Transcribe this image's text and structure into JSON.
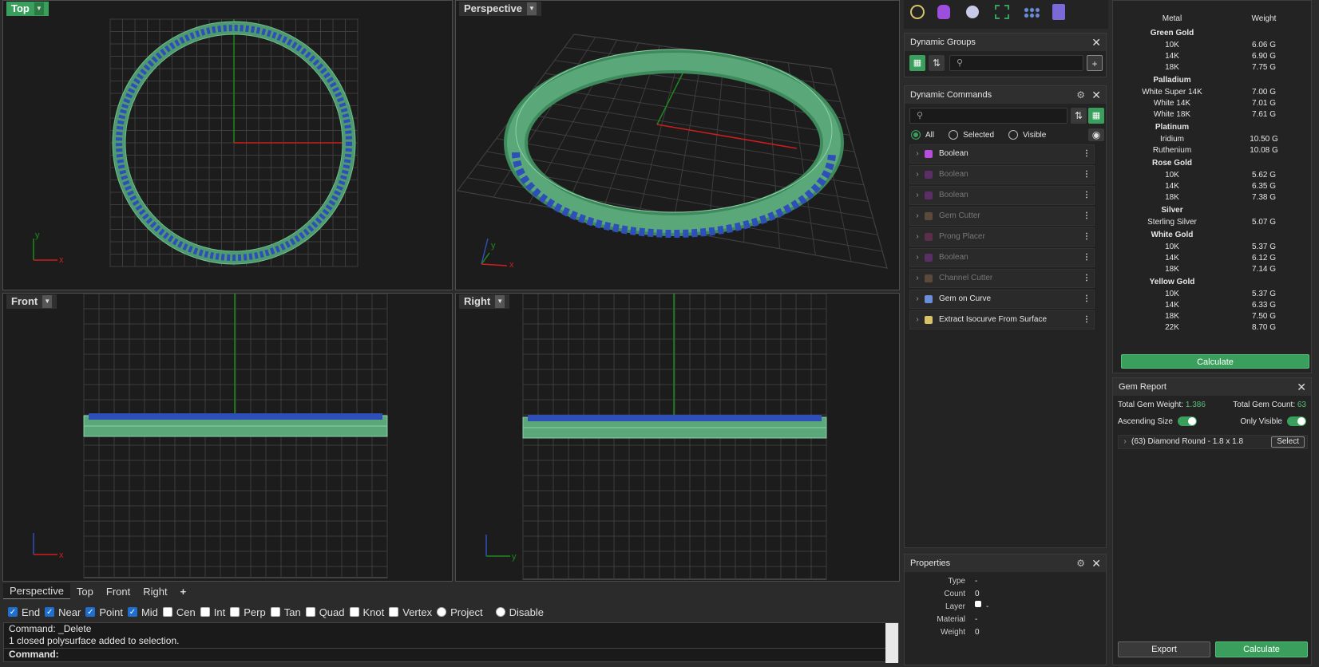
{
  "viewports": {
    "top": {
      "label": "Top",
      "x_axis": "x",
      "y_axis": "y"
    },
    "perspective": {
      "label": "Perspective",
      "x_axis": "x",
      "y_axis": "y"
    },
    "front": {
      "label": "Front",
      "x_axis": "x"
    },
    "right": {
      "label": "Right",
      "y_axis": "y"
    }
  },
  "viewport_tabs": [
    "Perspective",
    "Top",
    "Front",
    "Right"
  ],
  "add_tab": "+",
  "osnaps": [
    {
      "label": "End",
      "checked": true
    },
    {
      "label": "Near",
      "checked": true
    },
    {
      "label": "Point",
      "checked": true
    },
    {
      "label": "Mid",
      "checked": true
    },
    {
      "label": "Cen",
      "checked": false
    },
    {
      "label": "Int",
      "checked": false
    },
    {
      "label": "Perp",
      "checked": false
    },
    {
      "label": "Tan",
      "checked": false
    },
    {
      "label": "Quad",
      "checked": false
    },
    {
      "label": "Knot",
      "checked": false
    },
    {
      "label": "Vertex",
      "checked": false
    },
    {
      "label": "Project",
      "checked": false,
      "radio": true
    },
    {
      "label": "Disable",
      "checked": false,
      "radio": true
    }
  ],
  "command": {
    "history1": "Command: _Delete",
    "history2": "1 closed polysurface added to selection.",
    "prompt": "Command:"
  },
  "dynamic_groups": {
    "title": "Dynamic Groups",
    "add": "+"
  },
  "dynamic_commands": {
    "title": "Dynamic Commands",
    "filters": [
      "All",
      "Selected",
      "Visible"
    ],
    "items": [
      {
        "label": "Boolean",
        "color": "#b84fdc",
        "active": true
      },
      {
        "label": "Boolean",
        "color": "#5a2f66",
        "active": false
      },
      {
        "label": "Boolean",
        "color": "#5a2f66",
        "active": false
      },
      {
        "label": "Gem Cutter",
        "color": "#5a4a3c",
        "active": false
      },
      {
        "label": "Prong Placer",
        "color": "#5a2f4a",
        "active": false
      },
      {
        "label": "Boolean",
        "color": "#5a2f66",
        "active": false
      },
      {
        "label": "Channel Cutter",
        "color": "#5a4a3c",
        "active": false
      },
      {
        "label": "Gem on Curve",
        "color": "#6a8fd8",
        "active": true
      },
      {
        "label": "Extract Isocurve From Surface",
        "color": "#d8c36a",
        "active": true
      }
    ]
  },
  "properties": {
    "title": "Properties",
    "rows": [
      {
        "key": "Type",
        "value": "-"
      },
      {
        "key": "Count",
        "value": "0"
      },
      {
        "key": "Layer",
        "value": "-"
      },
      {
        "key": "Material",
        "value": "-"
      },
      {
        "key": "Weight",
        "value": "0"
      }
    ]
  },
  "metals": {
    "col_metal": "Metal",
    "col_weight": "Weight",
    "groups": [
      {
        "name": "Green Gold",
        "rows": [
          [
            "10K",
            "6.06 G"
          ],
          [
            "14K",
            "6.90 G"
          ],
          [
            "18K",
            "7.75 G"
          ]
        ]
      },
      {
        "name": "Palladium",
        "rows": [
          [
            "White Super 14K",
            "7.00 G"
          ],
          [
            "White 14K",
            "7.01 G"
          ],
          [
            "White 18K",
            "7.61 G"
          ]
        ]
      },
      {
        "name": "Platinum",
        "rows": [
          [
            "Iridium",
            "10.50 G"
          ],
          [
            "Ruthenium",
            "10.08 G"
          ]
        ]
      },
      {
        "name": "Rose Gold",
        "rows": [
          [
            "10K",
            "5.62 G"
          ],
          [
            "14K",
            "6.35 G"
          ],
          [
            "18K",
            "7.38 G"
          ]
        ]
      },
      {
        "name": "Silver",
        "rows": [
          [
            "Sterling Silver",
            "5.07 G"
          ]
        ]
      },
      {
        "name": "White Gold",
        "rows": [
          [
            "10K",
            "5.37 G"
          ],
          [
            "14K",
            "6.12 G"
          ],
          [
            "18K",
            "7.14 G"
          ]
        ]
      },
      {
        "name": "Yellow Gold",
        "rows": [
          [
            "10K",
            "5.37 G"
          ],
          [
            "14K",
            "6.33 G"
          ],
          [
            "18K",
            "7.50 G"
          ],
          [
            "22K",
            "8.70 G"
          ]
        ]
      }
    ],
    "calculate": "Calculate"
  },
  "gem_report": {
    "title": "Gem Report",
    "total_weight_label": "Total Gem Weight:",
    "total_weight_value": "1.386",
    "total_count_label": "Total Gem Count:",
    "total_count_value": "63",
    "ascending_label": "Ascending Size",
    "only_visible_label": "Only Visible",
    "item": "(63) Diamond Round - 1.8 x 1.8",
    "select": "Select",
    "export": "Export",
    "calculate": "Calculate"
  },
  "colors": {
    "accent": "#3a9f5c",
    "gem_blue": "#2e4fb8",
    "metal_green": "#4e9a6e"
  }
}
